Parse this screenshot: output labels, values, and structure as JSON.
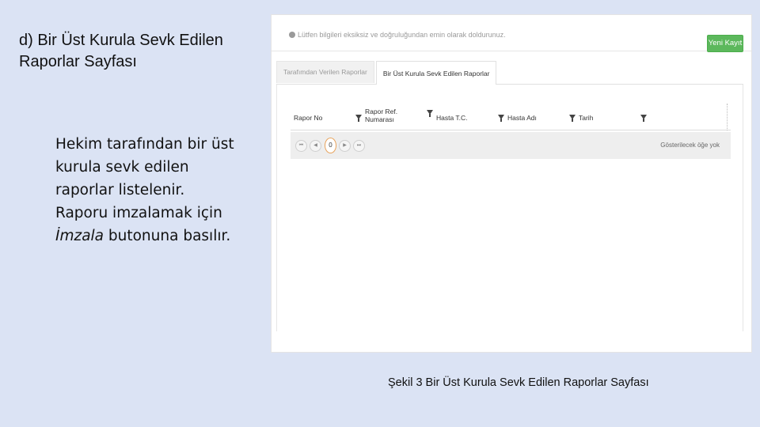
{
  "slide": {
    "title": "d)  Bir Üst Kurula Sevk Edilen Raporlar Sayfası",
    "desc_part1": "Hekim tarafından bir üst kurula sevk edilen raporlar listelenir. Raporu imzalamak için ",
    "desc_emphasis": "İmzala",
    "desc_part2": " butonuna basılır.",
    "caption": "Şekil 3  Bir Üst Kurula Sevk Edilen Raporlar Sayfası"
  },
  "screen": {
    "info_text": "Lütfen bilgileri eksiksiz ve doğruluğundan emin olarak doldurunuz.",
    "new_button": "Yeni Kayıt",
    "tabs": [
      {
        "label": "Tarafımdan Verilen Raporlar",
        "active": false
      },
      {
        "label": "Bir Üst Kurula Sevk Edilen Raporlar",
        "active": true
      }
    ],
    "columns": [
      {
        "label": "Rapor No"
      },
      {
        "label": "Rapor Ref. Numarası"
      },
      {
        "label": "Hasta T.C."
      },
      {
        "label": "Hasta Adı"
      },
      {
        "label": "Tarih"
      }
    ],
    "pager": {
      "first": "⏮",
      "prev": "◀",
      "page": "0",
      "next": "▶",
      "last": "⏭",
      "message": "Gösterilecek öğe yok"
    },
    "colors": {
      "accent_green": "#5cb85c",
      "pager_highlight": "#e8a25a",
      "slide_background": "#dbe3f4"
    }
  }
}
